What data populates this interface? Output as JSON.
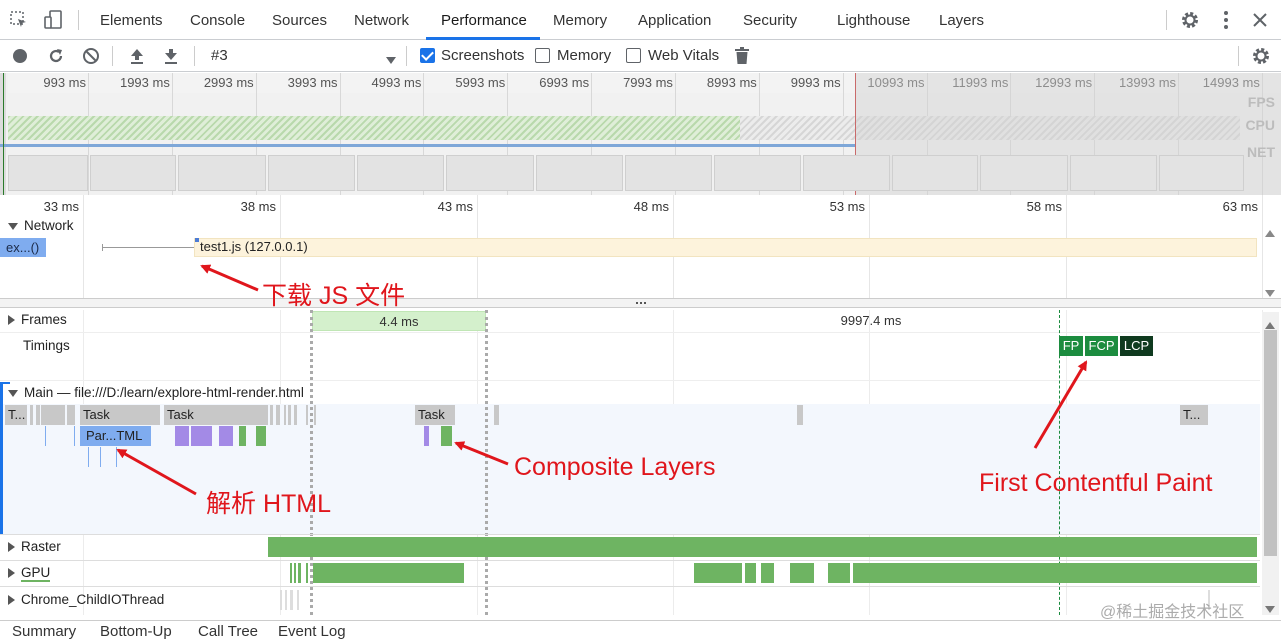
{
  "tabs": [
    {
      "label": "Elements"
    },
    {
      "label": "Console"
    },
    {
      "label": "Sources"
    },
    {
      "label": "Network"
    },
    {
      "label": "Performance"
    },
    {
      "label": "Memory"
    },
    {
      "label": "Application"
    },
    {
      "label": "Security"
    },
    {
      "label": "Lighthouse"
    },
    {
      "label": "Layers"
    }
  ],
  "active_tab": "Performance",
  "toolbar": {
    "profile_select": "#3",
    "screenshots_label": "Screenshots",
    "screenshots_checked": true,
    "memory_label": "Memory",
    "memory_checked": false,
    "webvitals_label": "Web Vitals",
    "webvitals_checked": false
  },
  "overview": {
    "ticks": [
      "993 ms",
      "1993 ms",
      "2993 ms",
      "3993 ms",
      "4993 ms",
      "5993 ms",
      "6993 ms",
      "7993 ms",
      "8993 ms",
      "9993 ms",
      "10993 ms",
      "11993 ms",
      "12993 ms",
      "13993 ms",
      "14993 ms"
    ],
    "fps_label": "FPS",
    "cpu_label": "CPU",
    "net_label": "NET"
  },
  "ruler_ticks": [
    "33 ms",
    "38 ms",
    "43 ms",
    "48 ms",
    "53 ms",
    "58 ms",
    "63 ms"
  ],
  "network": {
    "label": "Network",
    "request_short": "ex...()",
    "request_file": "test1.js (127.0.0.1)"
  },
  "frames": {
    "label": "Frames",
    "frame1": "4.4 ms",
    "frame2": "9997.4 ms"
  },
  "timings": {
    "label": "Timings",
    "fp": "FP",
    "fcp": "FCP",
    "lcp": "LCP"
  },
  "main": {
    "label": "Main — file:///D:/learn/explore-html-render.html",
    "task_short": "T...",
    "task1": "Task",
    "task2": "Task",
    "task3": "Task",
    "task_end": "T...",
    "parse_html": "Par...TML"
  },
  "tracks": {
    "raster": "Raster",
    "gpu": "GPU",
    "child_io": "Chrome_ChildIOThread"
  },
  "annotations": {
    "download_js": "下载 JS 文件",
    "parse_html": "解析 HTML",
    "composite": "Composite Layers",
    "fcp": "First Contentful Paint"
  },
  "bottom_tabs": [
    "Summary",
    "Bottom-Up",
    "Call Tree",
    "Event Log"
  ],
  "watermark": "@稀土掘金技术社区",
  "colors": {
    "accent": "#1a73e8",
    "task_gray": "#c8c8c8",
    "parse_blue": "#7facef",
    "paint_green": "#6eb462",
    "layout_purple": "#a38ae6",
    "timing_green": "#1c8c3f",
    "timing_dark": "#0f3a1f",
    "annotation_red": "#e0161c"
  }
}
